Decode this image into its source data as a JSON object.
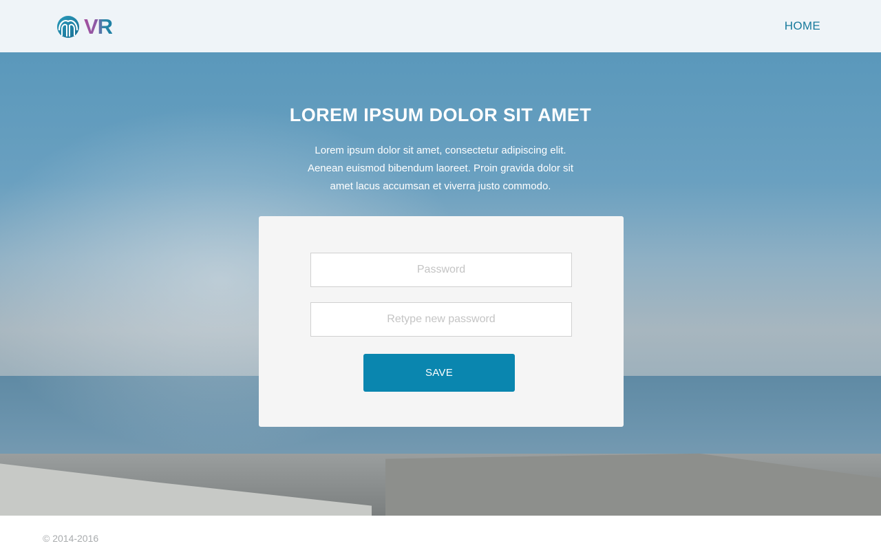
{
  "header": {
    "logo_text": "VR",
    "nav_home": "HOME"
  },
  "hero": {
    "title": "LOREM IPSUM DOLOR SIT AMET",
    "text": "Lorem ipsum dolor sit amet, consectetur adipiscing elit. Aenean euismod bibendum laoreet. Proin gravida dolor sit amet lacus accumsan et viverra justo commodo."
  },
  "form": {
    "password_placeholder": "Password",
    "password_value": "",
    "retype_placeholder": "Retype new password",
    "retype_value": "",
    "save_label": "SAVE"
  },
  "footer": {
    "copyright": "© 2014-2016"
  },
  "colors": {
    "header_bg": "#eff4f8",
    "accent": "#0a86af",
    "nav_link": "#177a9c",
    "card_bg": "#f5f5f5"
  },
  "icons": {
    "logo": "fountain-logo-icon"
  }
}
